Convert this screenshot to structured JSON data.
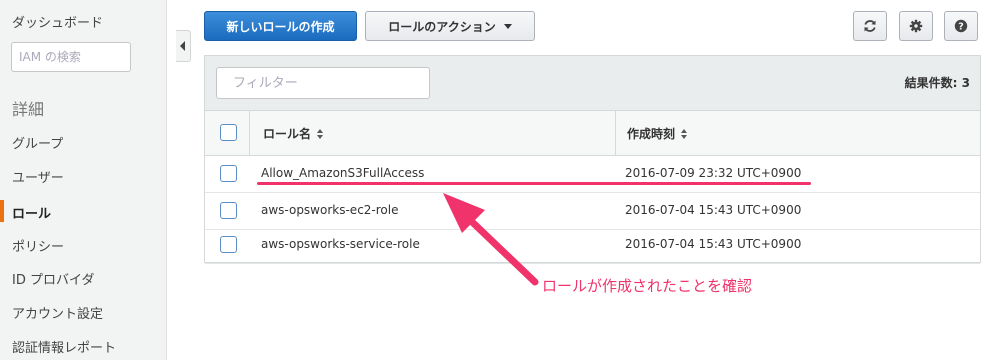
{
  "sidebar": {
    "dashboard": "ダッシュボード",
    "search_placeholder": "IAM の検索",
    "section_title": "詳細",
    "items": [
      {
        "label": "グループ"
      },
      {
        "label": "ユーザー"
      },
      {
        "label": "ロール"
      },
      {
        "label": "ポリシー"
      },
      {
        "label": "ID プロバイダ"
      },
      {
        "label": "アカウント設定"
      },
      {
        "label": "認証情報レポート"
      }
    ],
    "active_item": "ロール",
    "accent_color": "#ec7211"
  },
  "toolbar": {
    "create_role": "新しいロールの作成",
    "role_actions": "ロールのアクション",
    "icons": [
      "refresh-icon",
      "gear-icon",
      "help-icon"
    ]
  },
  "filter": {
    "placeholder": "フィルター",
    "result_count": "結果件数: 3"
  },
  "table": {
    "columns": [
      "ロール名",
      "作成時刻"
    ],
    "rows": [
      {
        "name": "Allow_AmazonS3FullAccess",
        "created": "2016-07-09 23:32 UTC+0900"
      },
      {
        "name": "aws-opsworks-ec2-role",
        "created": "2016-07-04 15:43 UTC+0900"
      },
      {
        "name": "aws-opsworks-service-role",
        "created": "2016-07-04 15:43 UTC+0900"
      }
    ]
  },
  "annotation": {
    "text": "ロールが作成されたことを確認",
    "color": "#f0336a"
  }
}
